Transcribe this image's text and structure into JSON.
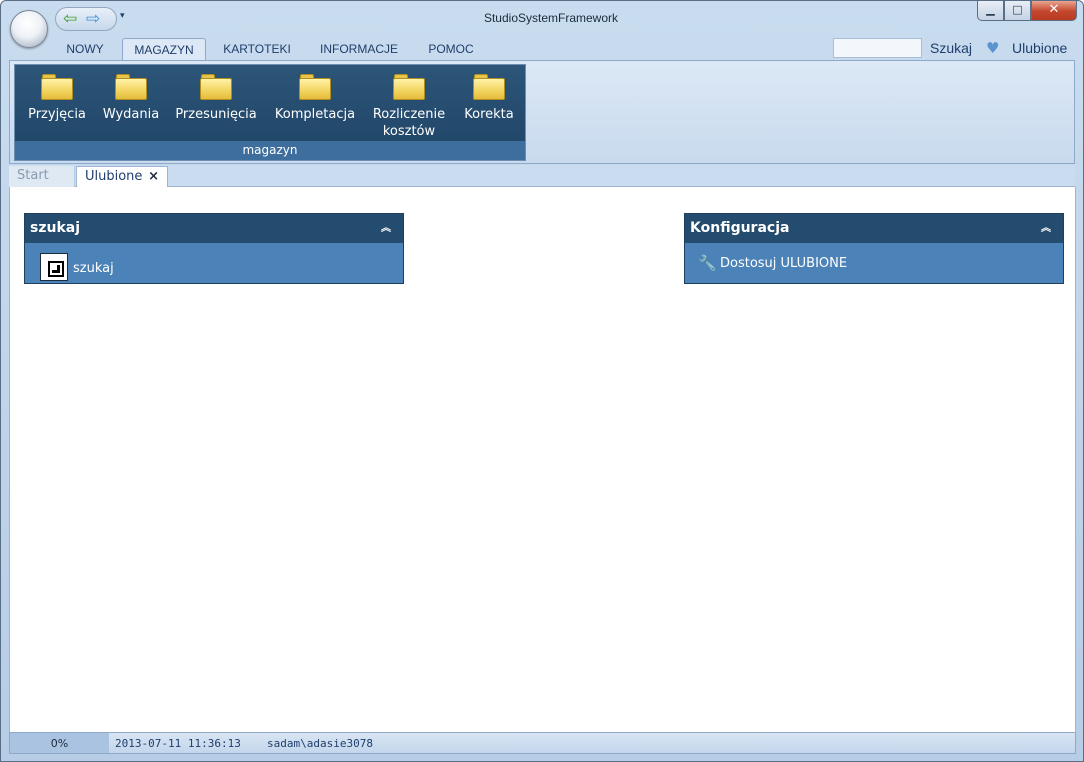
{
  "window": {
    "title": "StudioSystemFramework",
    "min_glyph": "▁",
    "max_glyph": "□",
    "close_glyph": "✕"
  },
  "quick_access": {
    "back_glyph": "⇦",
    "forward_glyph": "⇨",
    "more_glyph": "▾",
    "back_icon": "back-arrow-icon",
    "forward_icon": "forward-arrow-icon"
  },
  "ribbon": {
    "tabs": [
      {
        "label": "NOWY",
        "active": false
      },
      {
        "label": "MAGAZYN",
        "active": true
      },
      {
        "label": "KARTOTEKI",
        "active": false
      },
      {
        "label": "INFORMACJE",
        "active": false
      },
      {
        "label": "POMOC",
        "active": false
      }
    ],
    "search": {
      "value": "",
      "label": "Szukaj"
    },
    "favorites": {
      "label": "Ulubione",
      "icon": "heart-icon",
      "glyph": "♥"
    },
    "group": {
      "caption": "magazyn",
      "buttons": [
        {
          "label": "Przyjęcia",
          "icon": "folder-icon"
        },
        {
          "label": "Wydania",
          "icon": "folder-icon"
        },
        {
          "label": "Przesunięcia",
          "icon": "folder-icon"
        },
        {
          "label": "Kompletacja",
          "icon": "folder-icon"
        },
        {
          "label_line1": "Rozliczenie",
          "label_line2": "kosztów",
          "icon": "folder-icon"
        },
        {
          "label": "Korekta",
          "icon": "folder-icon"
        }
      ]
    }
  },
  "doc_tabs": {
    "start": "Start",
    "ulubione": "Ulubione",
    "close_glyph": "×"
  },
  "panels": {
    "left": {
      "title": "szukaj",
      "chevron": "︽",
      "link": "szukaj",
      "icon": "search-box-icon"
    },
    "right": {
      "title": "Konfiguracja",
      "chevron": "︽",
      "link": "Dostosuj ULUBIONE",
      "icon": "wrench-icon",
      "glyph": "🔧"
    }
  },
  "status": {
    "progress_percent": 0,
    "progress_label": "0%",
    "datetime": "2013-07-11 11:36:13",
    "user": "sadam\\adasie3078"
  },
  "colors": {
    "panel_header": "#244c6f",
    "panel_body": "#4b82b8",
    "ribbon_group": "#1f4466",
    "accent_text": "#1f3e6b"
  }
}
